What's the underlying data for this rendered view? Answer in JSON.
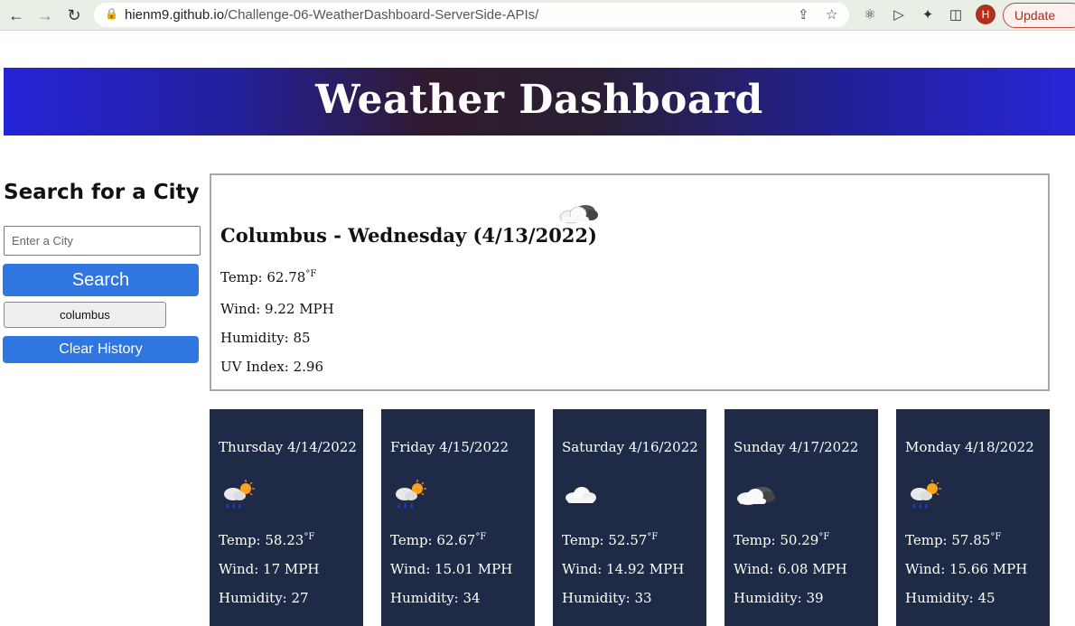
{
  "browser": {
    "url_host": "hienm9.github.io",
    "url_path": "/Challenge-06-WeatherDashboard-ServerSide-APIs/",
    "avatar_letter": "H",
    "update_label": "Update"
  },
  "header": {
    "title": "Weather Dashboard"
  },
  "sidebar": {
    "title": "Search for a City",
    "input_placeholder": "Enter a City",
    "search_label": "Search",
    "history": [
      "columbus"
    ],
    "clear_label": "Clear History"
  },
  "current": {
    "heading": "Columbus - Wednesday (4/13/2022)",
    "icon": "partly-cloudy-icon",
    "temp_label": "Temp: 62.78",
    "wind": "Wind: 9.22 MPH",
    "humidity": "Humidity: 85",
    "uv": "UV Index: 2.96"
  },
  "unit": "°F",
  "forecast": [
    {
      "date": "Thursday 4/14/2022",
      "icon": "rain-sun-icon",
      "temp": "Temp: 58.23",
      "wind": "Wind: 17 MPH",
      "humidity": "Humidity: 27"
    },
    {
      "date": "Friday 4/15/2022",
      "icon": "rain-sun-icon",
      "temp": "Temp: 62.67",
      "wind": "Wind: 15.01 MPH",
      "humidity": "Humidity: 34"
    },
    {
      "date": "Saturday 4/16/2022",
      "icon": "cloud-icon",
      "temp": "Temp: 52.57",
      "wind": "Wind: 14.92 MPH",
      "humidity": "Humidity: 33"
    },
    {
      "date": "Sunday 4/17/2022",
      "icon": "partly-cloudy-icon",
      "temp": "Temp: 50.29",
      "wind": "Wind: 6.08 MPH",
      "humidity": "Humidity: 39"
    },
    {
      "date": "Monday 4/18/2022",
      "icon": "rain-sun-icon",
      "temp": "Temp: 57.85",
      "wind": "Wind: 15.66 MPH",
      "humidity": "Humidity: 45"
    }
  ],
  "colors": {
    "header_blue": "#2424d8",
    "button_blue": "#2f76e0",
    "card_navy": "#1f2a46"
  }
}
